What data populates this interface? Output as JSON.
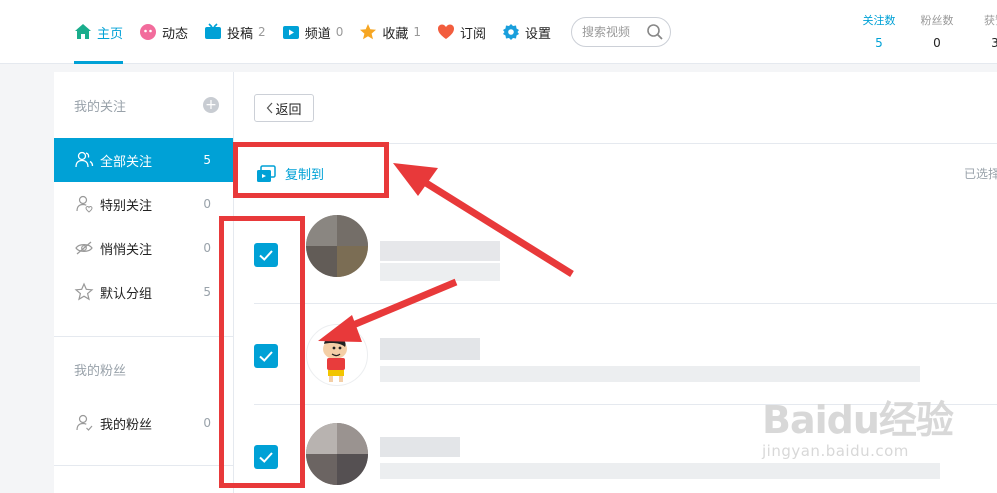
{
  "nav": {
    "items": [
      {
        "label": "主页",
        "count": "",
        "icon": "home-icon",
        "active": true
      },
      {
        "label": "动态",
        "count": "",
        "icon": "flower-icon"
      },
      {
        "label": "投稿",
        "count": "2",
        "icon": "tv-icon"
      },
      {
        "label": "频道",
        "count": "0",
        "icon": "channel-play-icon"
      },
      {
        "label": "收藏",
        "count": "1",
        "icon": "star-icon"
      },
      {
        "label": "订阅",
        "count": "",
        "icon": "heart-icon"
      },
      {
        "label": "设置",
        "count": "",
        "icon": "gear-icon"
      }
    ],
    "search_placeholder": "搜索视频"
  },
  "stats": [
    {
      "label": "关注数",
      "value": "5"
    },
    {
      "label": "粉丝数",
      "value": "0"
    },
    {
      "label": "获赞",
      "value": "3"
    }
  ],
  "sidebar": {
    "follow_title": "我的关注",
    "add_symbol": "+",
    "items": [
      {
        "label": "全部关注",
        "count": "5"
      },
      {
        "label": "特别关注",
        "count": "0"
      },
      {
        "label": "悄悄关注",
        "count": "0"
      },
      {
        "label": "默认分组",
        "count": "5"
      }
    ],
    "fans_title": "我的粉丝",
    "fans_item": {
      "label": "我的粉丝",
      "count": "0"
    }
  },
  "main": {
    "back_label": "返回",
    "copy_label": "复制到",
    "selected_label": "已选择"
  },
  "colors": {
    "accent": "#00a1d6",
    "annotation": "#e8393a"
  },
  "watermark": {
    "main": "Baidu经验",
    "sub": "jingyan.baidu.com"
  }
}
